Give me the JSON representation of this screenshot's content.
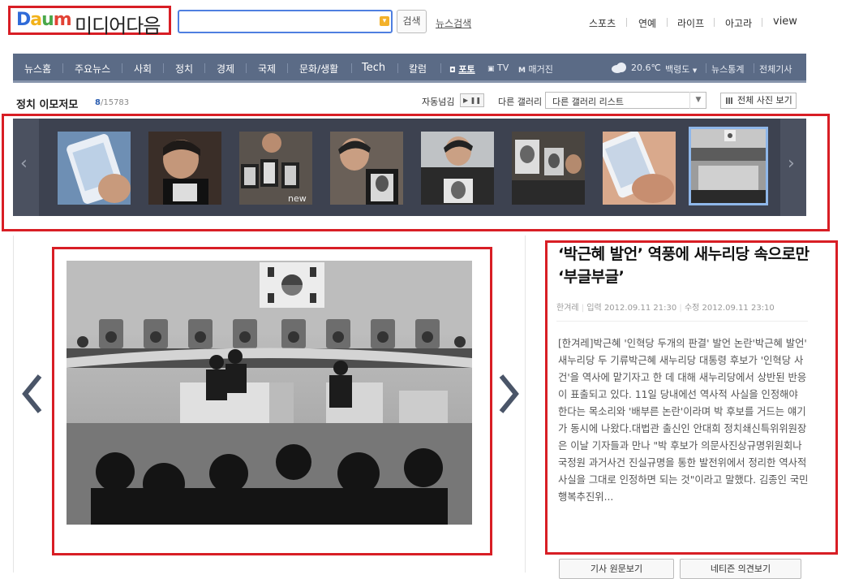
{
  "header": {
    "logo_brand": "DAUM",
    "logo_text": "미디어다음",
    "search": {
      "placeholder": "",
      "button_label": "검색",
      "news_search_label": "뉴스검색"
    },
    "top_links": [
      "스포츠",
      "연예",
      "라이프",
      "아고라",
      "view"
    ]
  },
  "nav": {
    "items": [
      "뉴스홈",
      "주요뉴스",
      "사회",
      "정치",
      "경제",
      "국제",
      "문화/생활",
      "Tech",
      "칼럼"
    ],
    "media_items": [
      "포토",
      "TV",
      "매거진"
    ],
    "weather": {
      "temp": "20.6℃",
      "location": "백령도"
    },
    "right_links": [
      "뉴스통계",
      "전체기사"
    ]
  },
  "gallery": {
    "title": "정치 이모저모",
    "current": "8",
    "total": "/15783",
    "autoplay_label": "자동넘김",
    "other_label": "다른 갤러리",
    "other_select_value": "다른 갤러리 리스트",
    "all_photos_label": "전체 사진 보기",
    "thumbnails": [
      {
        "watermark": ""
      },
      {
        "watermark": ""
      },
      {
        "watermark": ""
      },
      {
        "watermark": ""
      },
      {
        "watermark": ""
      },
      {
        "watermark": ""
      },
      {
        "watermark": ""
      },
      {
        "watermark": ""
      }
    ],
    "selected_index": 7
  },
  "article": {
    "headline": "‘박근혜 발언’ 역풍에 새누리당 속으로만 ‘부글부글’",
    "source": "한겨레",
    "input_time": "입력 2012.09.11 21:30",
    "modified_time": "수정 2012.09.11 23:10",
    "body": "[한겨레]박근혜 '인혁당 두개의 판결' 발언 논란'박근혜 발언' 새누리당 두 기류박근혜 새누리당 대통령 후보가 '인혁당 사건'을 역사에 맡기자고 한 데 대해 새누리당에서 상반된 반응이 표출되고 있다. 11일 당내에선 역사적 사실을 인정해야 한다는 목소리와 '배부른 논란'이라며 박 후보를 거드는 얘기가 동시에 나왔다.대법관 출신인 안대희 정치쇄신특위위원장은 이날 기자들과 만나 \"박 후보가 의문사진상규명위원회나 국정원 과거사건 진실규명을 통한 발전위에서 정리한 역사적 사실을 그대로 인정하면 되는 것\"이라고 말했다. 김종인 국민행복추진위...",
    "buttons": [
      "기사 원문보기",
      "네티즌 의견보기"
    ]
  },
  "colors": {
    "accent_red": "#d81e25",
    "nav_bg": "#5b6b86",
    "strip_bg": "#3d4250",
    "link_blue": "#2a5db0"
  }
}
